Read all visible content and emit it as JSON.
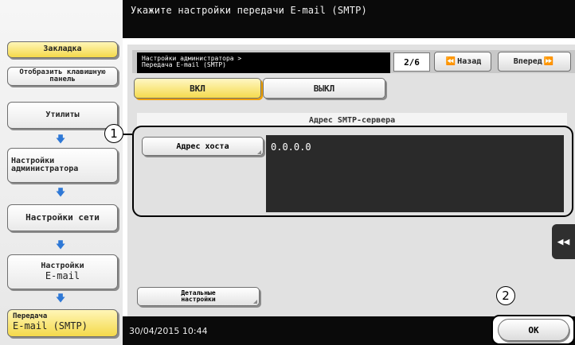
{
  "header": {
    "title": "Укажите настройки передачи  E-mail (SMTP)"
  },
  "sidebar": {
    "bookmark": "Закладка",
    "display_keypad": "Отобразить клавишную панель",
    "steps": [
      {
        "label": "Утилиты"
      },
      {
        "label": "Настройки администратора"
      },
      {
        "label": "Настройки сети"
      },
      {
        "label_line1": "Настройки",
        "label_line2": "E-mail"
      },
      {
        "label_line1": "Передача",
        "label_line2": "E-mail (SMTP)"
      }
    ]
  },
  "panel": {
    "breadcrumb_line1": "Настройки администратора >",
    "breadcrumb_line2": "Передача E-mail (SMTP)",
    "page": "2/6",
    "back_label": "Назад",
    "forward_label": "Вперед",
    "on_label": "ВКЛ",
    "off_label": "ВЫКЛ",
    "section_title": "Адрес SMTP-сервера",
    "host_button": "Адрес хоста",
    "host_value": "0.0.0.0",
    "detail_line1": "Детальные",
    "detail_line2": "настройки"
  },
  "footer": {
    "datetime": "30/04/2015  10:44",
    "ok_label": "OK"
  },
  "callouts": {
    "one": "1",
    "two": "2"
  },
  "colors": {
    "accent_yellow": "#f5db4e",
    "arrow_blue": "#2e78d6",
    "header_black": "#0a0a0a"
  }
}
